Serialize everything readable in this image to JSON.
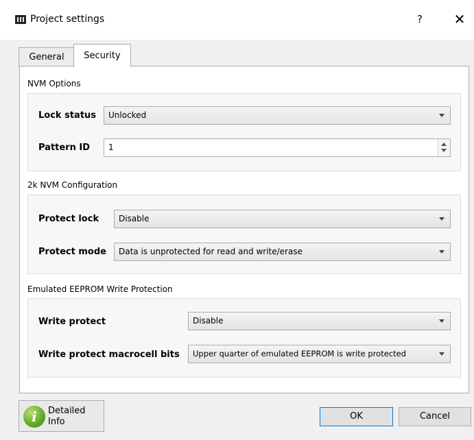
{
  "window": {
    "title": "Project settings",
    "help_glyph": "?",
    "close_glyph": "✕"
  },
  "tabs": [
    {
      "label": "General",
      "selected": false
    },
    {
      "label": "Security",
      "selected": true
    }
  ],
  "nvm_options": {
    "title": "NVM Options",
    "lock_status": {
      "label": "Lock status",
      "value": "Unlocked"
    },
    "pattern_id": {
      "label": "Pattern ID",
      "value": "1"
    }
  },
  "nvm_2k": {
    "title": "2k NVM Configuration",
    "protect_lock": {
      "label": "Protect lock",
      "value": "Disable"
    },
    "protect_mode": {
      "label": "Protect mode",
      "value": "Data is unprotected for read and write/erase"
    }
  },
  "eeprom": {
    "title": "Emulated EEPROM Write Protection",
    "write_protect": {
      "label": "Write protect",
      "value": "Disable"
    },
    "macrocell_bits": {
      "label": "Write protect macrocell bits",
      "value": "Upper quarter of emulated EEPROM is write protected"
    }
  },
  "footer": {
    "info_line1": "Detailed",
    "info_line2": "Info",
    "info_glyph": "i",
    "ok_label": "OK",
    "cancel_label": "Cancel"
  },
  "colors": {
    "accent": "#0078d7",
    "info_icon": "#5ea82a"
  }
}
